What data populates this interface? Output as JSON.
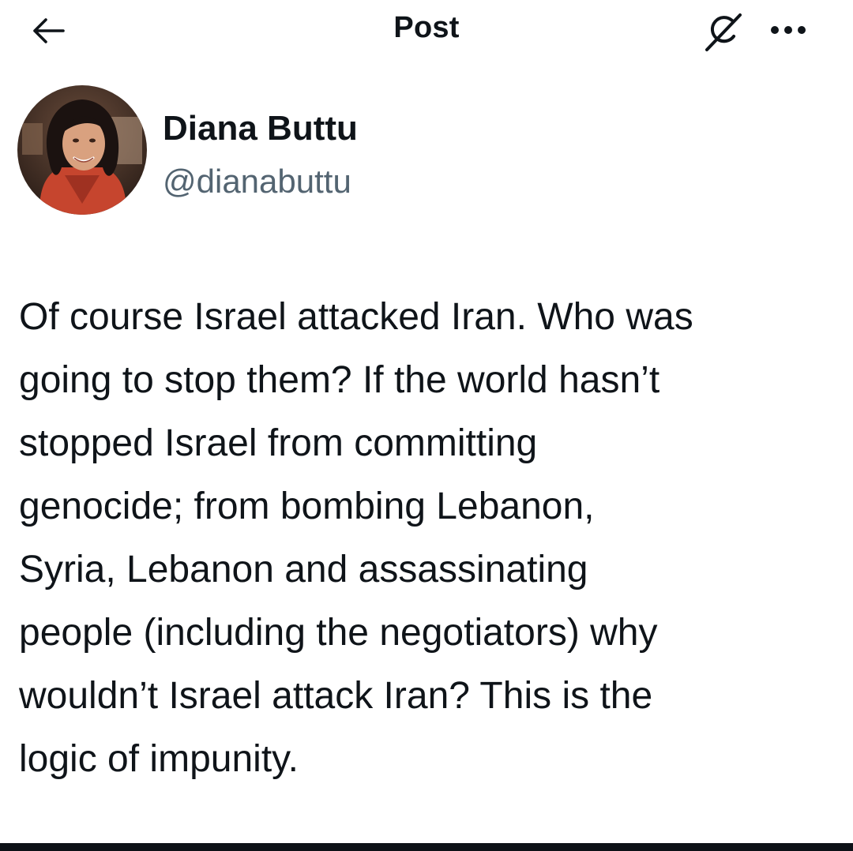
{
  "header": {
    "title": "Post",
    "back_icon": "arrow-left-icon",
    "grok_icon": "grok-slash-icon",
    "more_icon": "more-horizontal-icon"
  },
  "author": {
    "display_name": "Diana Buttu",
    "handle": "@dianabuttu"
  },
  "post": {
    "lines": [
      "Of course Israel attacked Iran. Who was",
      "going to stop them? If the world hasn’t",
      "stopped Israel from committing",
      "genocide; from bombing Lebanon,",
      "Syria, Lebanon and assassinating",
      "people (including the negotiators) why",
      "wouldn’t Israel attack Iran? This is the",
      "logic of impunity."
    ]
  },
  "colors": {
    "text_primary": "#0f1419",
    "text_secondary": "#536471",
    "background": "#ffffff",
    "bottom_bar": "#0d1117"
  }
}
